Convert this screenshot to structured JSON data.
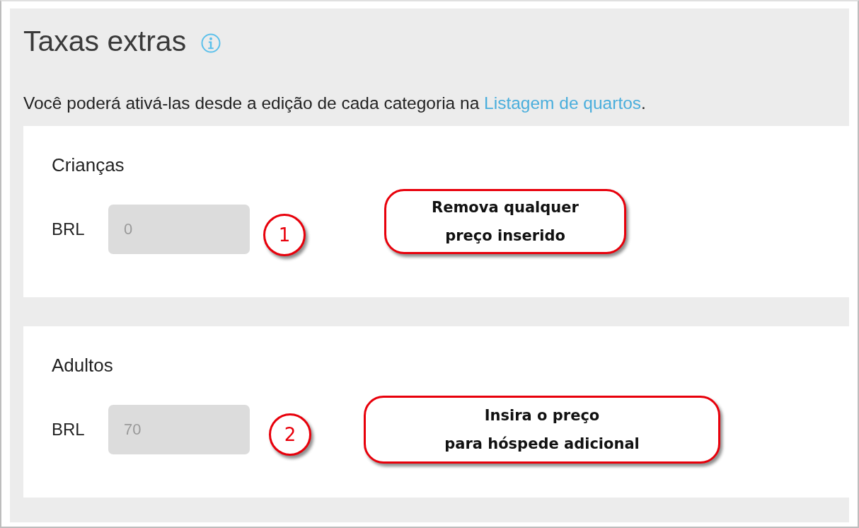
{
  "title": "Taxas extras",
  "description": {
    "text": "Você poderá ativá-las desde a edição de cada categoria na ",
    "link": "Listagem de quartos",
    "after": "."
  },
  "groups": [
    {
      "label": "Crianças",
      "currency": "BRL",
      "value": "0",
      "disabled": true,
      "annotation": {
        "number": "1",
        "note": "Remova qualquer\npreço inserido"
      }
    },
    {
      "label": "Adultos",
      "currency": "BRL",
      "value": "70",
      "disabled": true,
      "annotation": {
        "number": "2",
        "note": "Insira o preço\npara hóspede adicional"
      }
    }
  ]
}
